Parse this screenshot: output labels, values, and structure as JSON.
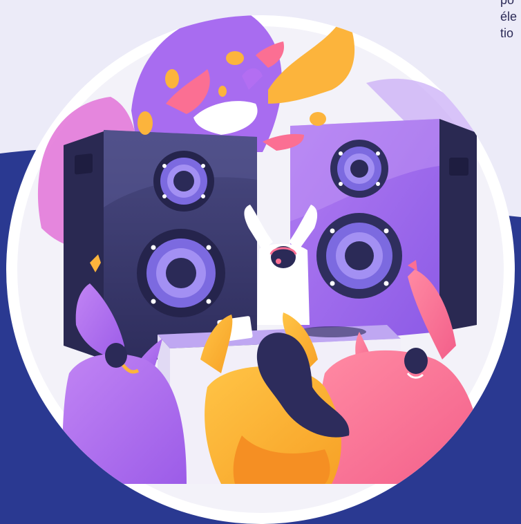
{
  "illustration": {
    "subject": "party-crowd-with-speakers",
    "colors": {
      "background_top": "#ecebf8",
      "background_band": "#2a3991",
      "circle": "#ffffff",
      "speaker_dark": "#353466",
      "speaker_purple": "#a26de9",
      "woofer_ring": "#8f7ce8",
      "accent_yellow": "#fcb43c",
      "accent_pink": "#fb6f93",
      "accent_violet": "#b36ef2"
    }
  },
  "side_text": {
    "line1": "po",
    "line2": "éle",
    "line3": "tio"
  }
}
